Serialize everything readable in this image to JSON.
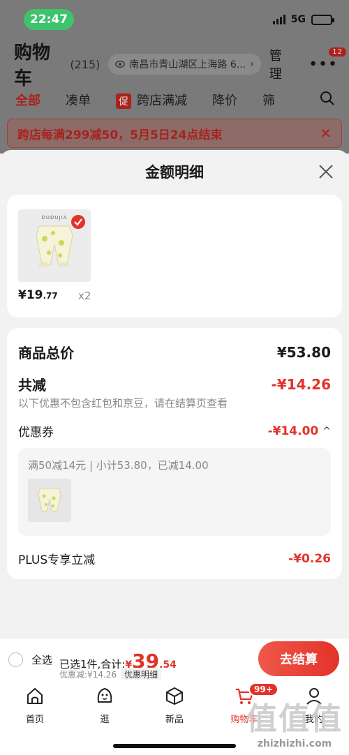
{
  "status": {
    "time": "22:47",
    "network": "5G"
  },
  "background": {
    "title": "购物车",
    "count": "(215)",
    "address": "南昌市青山湖区上海路 6...",
    "manage": "管理",
    "more_badge": "12",
    "tabs": [
      {
        "label": "全部",
        "active": true
      },
      {
        "label": "凑单"
      },
      {
        "label": "跨店满减",
        "tag": "促"
      },
      {
        "label": "降价"
      },
      {
        "label": "筛"
      }
    ],
    "banner": "跨店每满299减50，5月5日24点结束"
  },
  "sheet": {
    "title": "金额明细",
    "item": {
      "brand": "DUDUJIA",
      "price_int": "¥19",
      "price_dec": ".77",
      "qty": "x2"
    },
    "total_label": "商品总价",
    "total_value": "¥53.80",
    "discount_label": "共减",
    "discount_value": "-¥14.26",
    "discount_note": "以下优惠不包含红包和京豆，请在结算页查看",
    "coupon_label": "优惠券",
    "coupon_value": "-¥14.00",
    "coupon_detail": "满50减14元 | 小计53.80，已减14.00",
    "plus_label": "PLUS专享立减",
    "plus_value": "-¥0.26"
  },
  "checkout": {
    "select_all": "全选",
    "selected": "已选1件,合计:",
    "currency": "¥",
    "total_int": "39",
    "total_dec": ".54",
    "discount": "优惠减:¥14.26",
    "detail_button": "优惠明细",
    "pay_button": "去结算"
  },
  "tabbar": [
    {
      "label": "首页",
      "icon": "home-icon"
    },
    {
      "label": "逛",
      "icon": "face-icon"
    },
    {
      "label": "新品",
      "icon": "cube-icon"
    },
    {
      "label": "购物车",
      "icon": "cart-icon",
      "badge": "99+",
      "active": true
    },
    {
      "label": "我的",
      "icon": "person-icon"
    }
  ],
  "watermark": {
    "text": "值值值",
    "url": "zhizhizhi.com"
  },
  "colors": {
    "accent": "#e2332a",
    "pill": "#3ec46d"
  }
}
